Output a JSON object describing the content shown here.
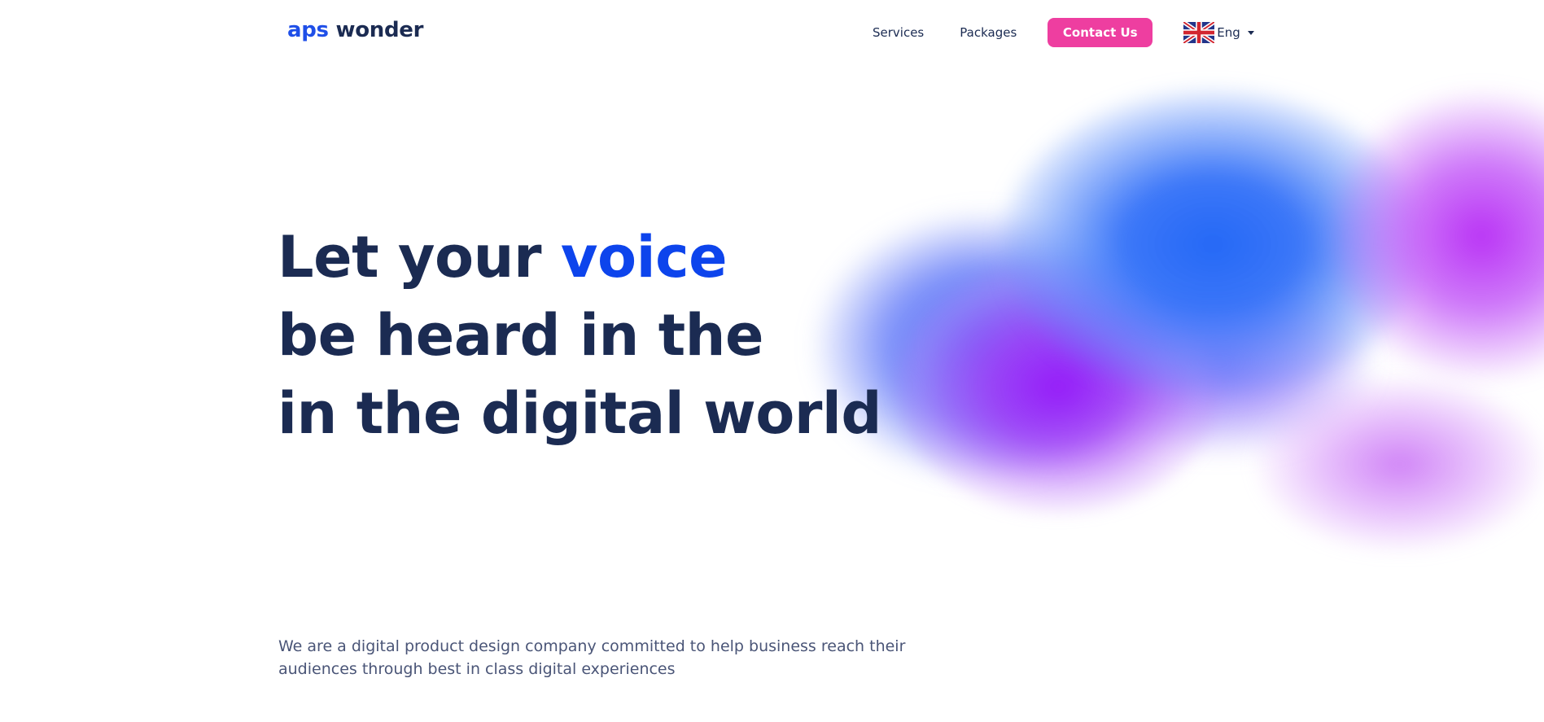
{
  "header": {
    "logo": {
      "part1": "aps",
      "part2": "wonder"
    },
    "nav": {
      "services": "Services",
      "packages": "Packages",
      "contact_button": "Contact Us"
    },
    "language": {
      "label": "Eng",
      "icon": "uk-flag-icon"
    }
  },
  "hero": {
    "title_line1_prefix": "Let your",
    "title_line1_accent": "voice",
    "title_line2": "be heard in the",
    "title_line3": "in the digital world",
    "description_line1": "We are a digital product design company committed to help business reach their",
    "description_line2": "audiences through best in class digital experiences"
  },
  "colors": {
    "primary_text": "#1b2b52",
    "accent_blue": "#0d44ec",
    "cta_pink": "#ee3ea0",
    "body_text": "#4a5577"
  }
}
